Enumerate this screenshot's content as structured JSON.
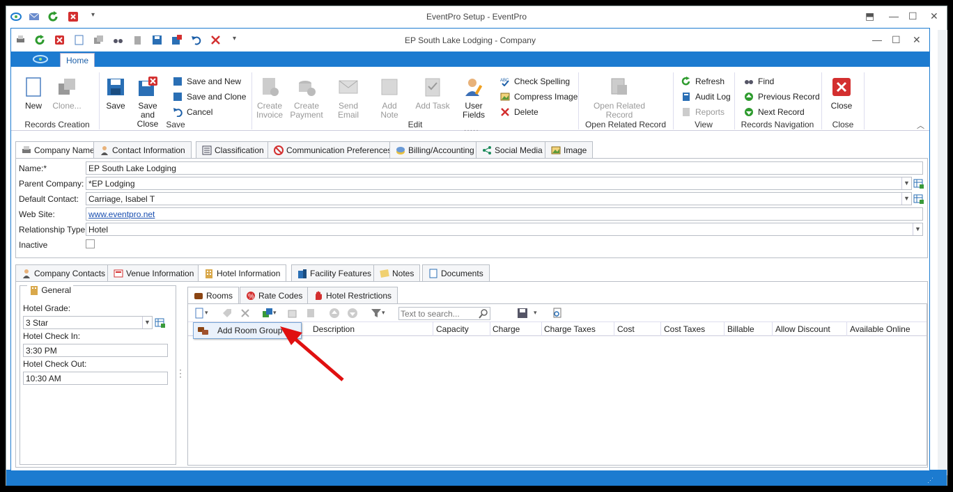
{
  "outer_title": "EventPro Setup - EventPro",
  "window_title": "EP South Lake Lodging - Company",
  "ribbon_tab": "Home",
  "ribbon": {
    "new": "New",
    "clone": "Clone...",
    "save": "Save",
    "save_close": "Save and Close",
    "save_new": "Save and New",
    "save_clone": "Save and Clone",
    "cancel": "Cancel",
    "create_invoice": "Create Invoice",
    "create_payment": "Create Payment",
    "send_email": "Send Email",
    "add_note": "Add Note",
    "add_task": "Add Task",
    "user_fields": "User Fields",
    "check_spelling": "Check Spelling",
    "compress_image": "Compress Image",
    "delete": "Delete",
    "open_related": "Open Related Record",
    "refresh": "Refresh",
    "audit_log": "Audit Log",
    "reports": "Reports",
    "find": "Find",
    "previous_record": "Previous Record",
    "next_record": "Next Record",
    "close": "Close",
    "groups": {
      "records_creation": "Records Creation",
      "save": "Save",
      "edit": "Edit",
      "open_related": "Open Related Record",
      "view": "View",
      "records_navigation": "Records Navigation",
      "close": "Close"
    }
  },
  "tabs_main": [
    "Company Name",
    "Contact Information",
    "Classification",
    "Communication Preferences",
    "Billing/Accounting",
    "Social Media",
    "Image"
  ],
  "form": {
    "name_label": "Name:*",
    "name": "EP South Lake Lodging",
    "parent_label": "Parent Company:",
    "parent": "*EP Lodging",
    "contact_label": "Default Contact:",
    "contact": "Carriage, Isabel T",
    "website_label": "Web Site:",
    "website": "www.eventpro.net",
    "relationship_label": "Relationship Type:",
    "relationship": "Hotel",
    "inactive_label": "Inactive"
  },
  "tabs_sub": [
    "Company Contacts",
    "Venue Information",
    "Hotel Information",
    "Facility Features",
    "Notes",
    "Documents"
  ],
  "general": {
    "title": "General",
    "grade_label": "Hotel Grade:",
    "grade": "3 Star",
    "checkin_label": "Hotel Check In:",
    "checkin": "3:30 PM",
    "checkout_label": "Hotel Check Out:",
    "checkout": "10:30 AM"
  },
  "tabs_rooms": [
    "Rooms",
    "Rate Codes",
    "Hotel Restrictions"
  ],
  "search_placeholder": "Text to search...",
  "columns": [
    "Description",
    "Capacity",
    "Charge",
    "Charge Taxes",
    "Cost",
    "Cost Taxes",
    "Billable",
    "Allow Discount",
    "Available Online"
  ],
  "popup_item": "Add Room Group",
  "colors": {
    "accent": "#1c7bd0",
    "delete_red": "#d32f2f",
    "arrow_red": "#e01010"
  }
}
